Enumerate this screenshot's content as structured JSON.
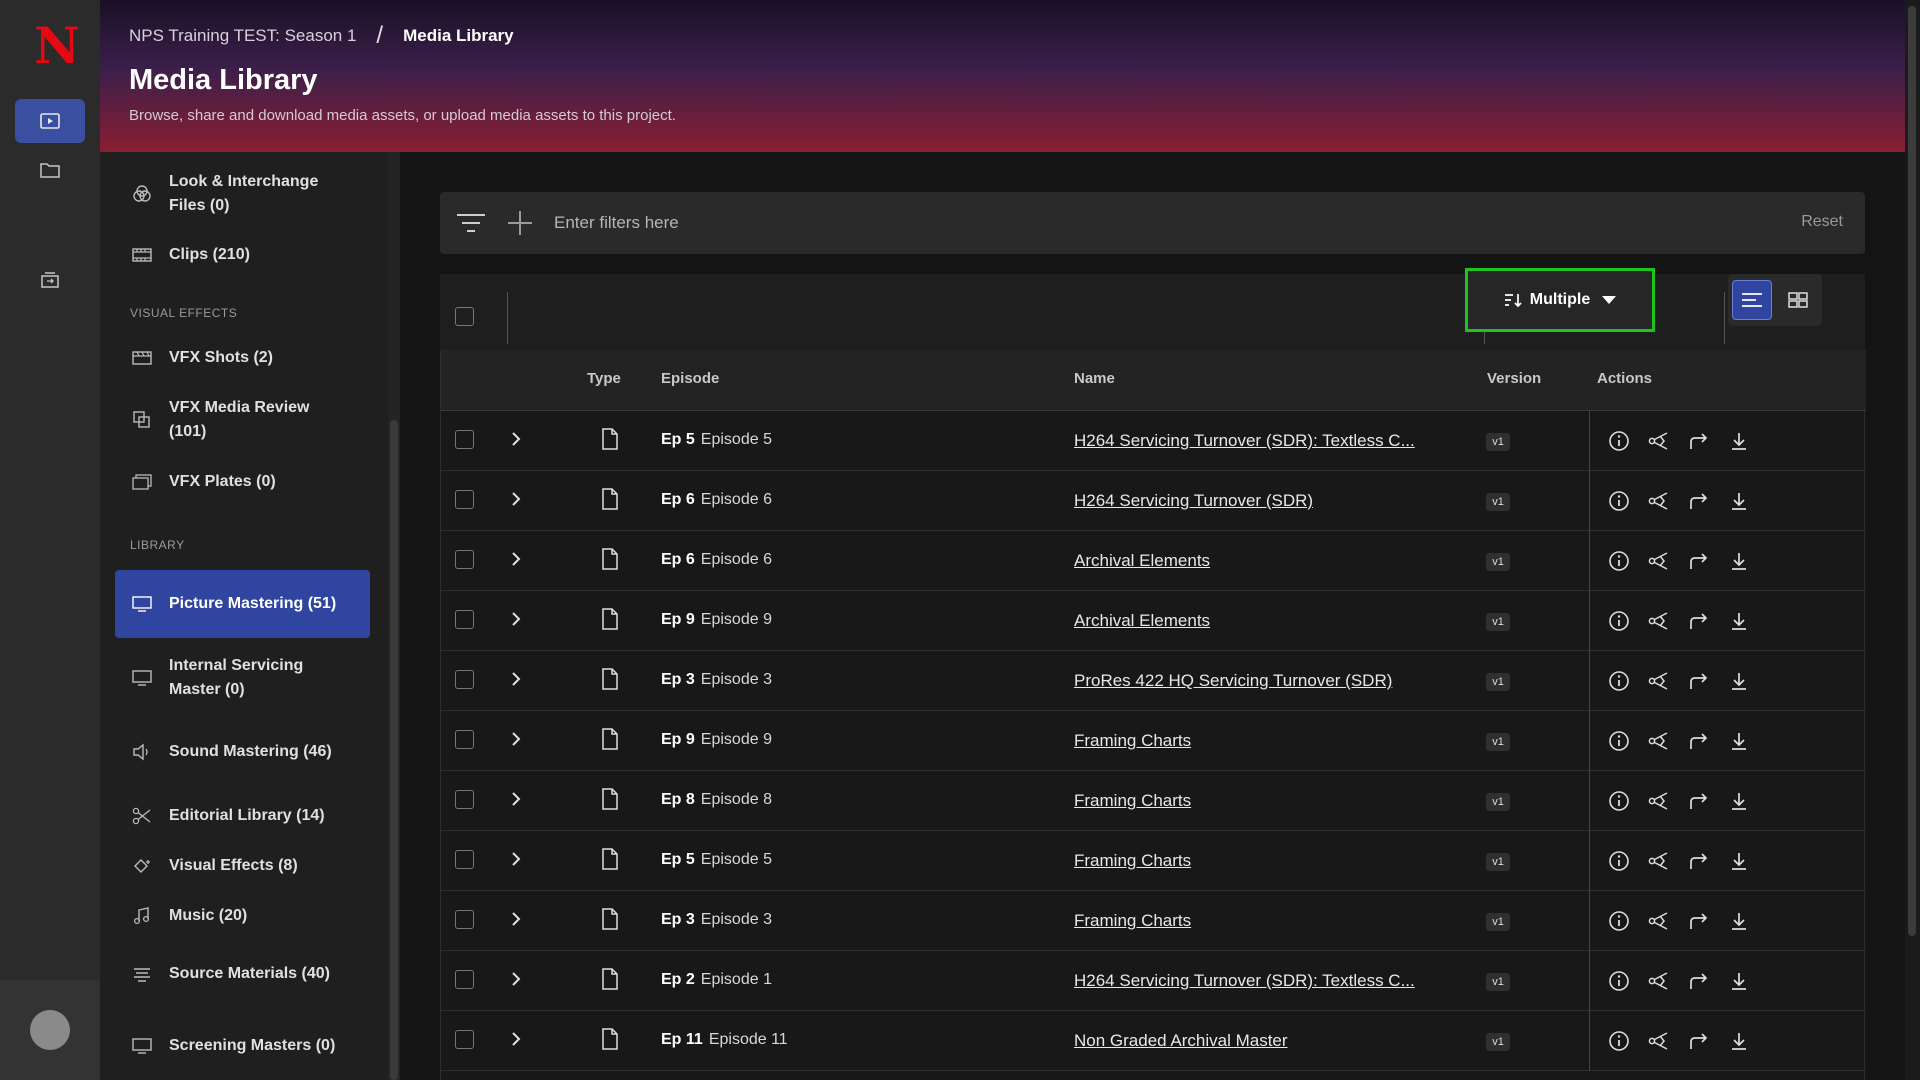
{
  "rail": {
    "brand_letter": "N",
    "items": [
      {
        "name": "media-library-icon",
        "active": true
      },
      {
        "name": "folder-icon",
        "active": false
      },
      {
        "name": "transfers-icon",
        "active": false
      }
    ]
  },
  "header": {
    "breadcrumb": {
      "project": "NPS Training TEST: Season 1",
      "separator": "/",
      "current": "Media Library"
    },
    "title": "Media Library",
    "subtitle": "Browse, share and download media assets, or upload media assets to this project."
  },
  "sidebar": {
    "items_top": [
      {
        "label": "Look & Interchange Files (0)",
        "icon": "look-icon"
      },
      {
        "label": "Clips (210)",
        "icon": "film-icon"
      }
    ],
    "vfx_section": "VISUAL EFFECTS",
    "vfx_items": [
      {
        "label": "VFX Shots (2)",
        "icon": "clapper-icon"
      },
      {
        "label": "VFX Media Review (101)",
        "icon": "review-icon"
      },
      {
        "label": "VFX Plates (0)",
        "icon": "plates-icon"
      }
    ],
    "library_section": "LIBRARY",
    "library_items": [
      {
        "label": "Picture Mastering (51)",
        "icon": "monitor-icon",
        "active": true
      },
      {
        "label": "Internal Servicing Master (0)",
        "icon": "monitor-icon"
      },
      {
        "label": "Sound Mastering (46)",
        "icon": "speaker-icon"
      },
      {
        "label": "Editorial Library (14)",
        "icon": "scissors-icon"
      },
      {
        "label": "Visual Effects (8)",
        "icon": "sparkle-icon"
      },
      {
        "label": "Music (20)",
        "icon": "music-icon"
      },
      {
        "label": "Source Materials (40)",
        "icon": "source-icon"
      },
      {
        "label": "Screening Masters (0)",
        "icon": "monitor-icon"
      }
    ]
  },
  "filters": {
    "placeholder": "Enter filters here",
    "reset_label": "Reset"
  },
  "toolbar": {
    "sort_label": "Multiple",
    "sort_icon": "sort-icon",
    "view_active": "list"
  },
  "table": {
    "columns": {
      "type": "Type",
      "episode": "Episode",
      "name": "Name",
      "version": "Version",
      "actions": "Actions"
    },
    "rows": [
      {
        "ep": "Ep 5",
        "episode": "Episode 5",
        "name": "H264 Servicing Turnover (SDR): Textless C...",
        "version": "v1"
      },
      {
        "ep": "Ep 6",
        "episode": "Episode 6",
        "name": "H264 Servicing Turnover (SDR)",
        "version": "v1"
      },
      {
        "ep": "Ep 6",
        "episode": "Episode 6",
        "name": "Archival Elements",
        "version": "v1"
      },
      {
        "ep": "Ep 9",
        "episode": "Episode 9",
        "name": "Archival Elements",
        "version": "v1"
      },
      {
        "ep": "Ep 3",
        "episode": "Episode 3",
        "name": "ProRes 422 HQ Servicing Turnover (SDR)",
        "version": "v1"
      },
      {
        "ep": "Ep 9",
        "episode": "Episode 9",
        "name": "Framing Charts",
        "version": "v1"
      },
      {
        "ep": "Ep 8",
        "episode": "Episode 8",
        "name": "Framing Charts",
        "version": "v1"
      },
      {
        "ep": "Ep 5",
        "episode": "Episode 5",
        "name": "Framing Charts",
        "version": "v1"
      },
      {
        "ep": "Ep 3",
        "episode": "Episode 3",
        "name": "Framing Charts",
        "version": "v1"
      },
      {
        "ep": "Ep 2",
        "episode": "Episode 1",
        "name": "H264 Servicing Turnover (SDR): Textless C...",
        "version": "v1"
      },
      {
        "ep": "Ep 11",
        "episode": "Episode 11",
        "name": "Non Graded Archival Master",
        "version": "v1"
      }
    ]
  },
  "colors": {
    "accent": "#2f45a0",
    "highlight": "#1ec41e",
    "brand": "#e50914"
  }
}
